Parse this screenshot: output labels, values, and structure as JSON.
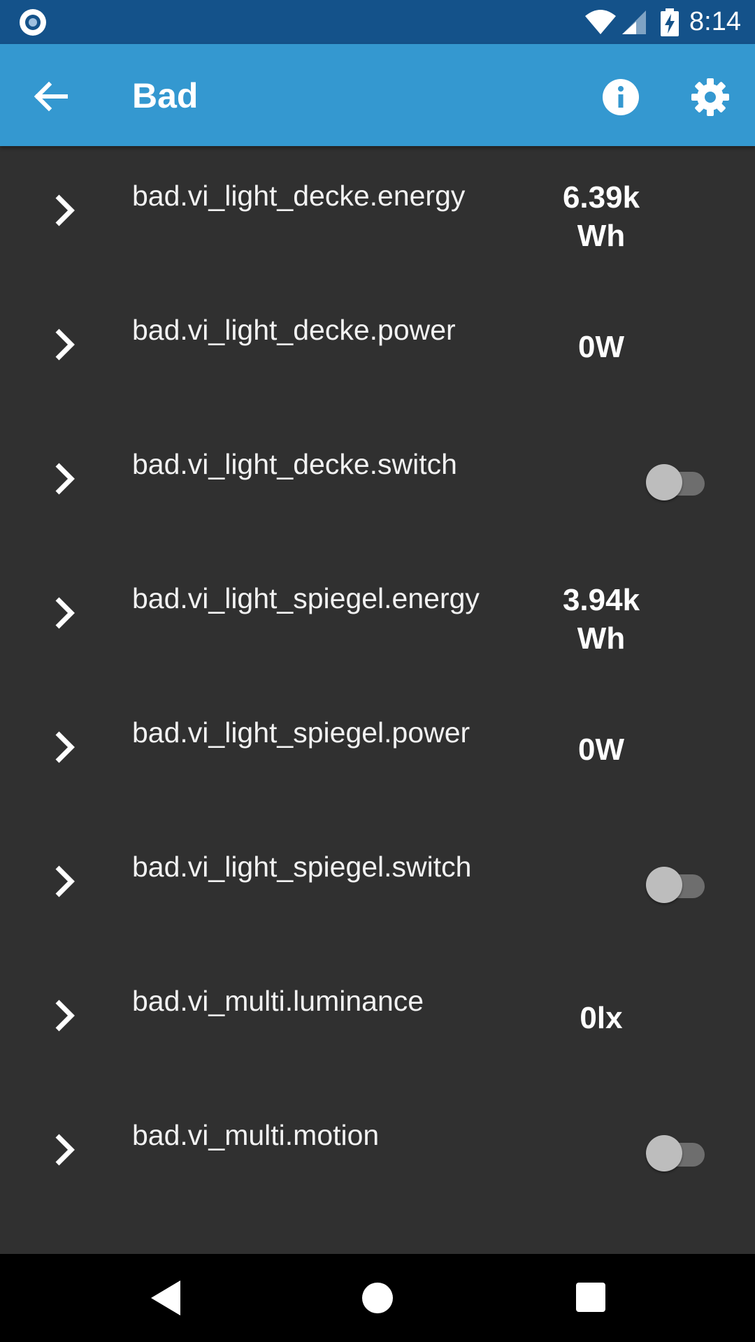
{
  "status_bar": {
    "time": "8:14",
    "icons": [
      "record-icon",
      "wifi-icon",
      "cell-signal-icon",
      "battery-charging-icon"
    ]
  },
  "app_bar": {
    "title": "Bad",
    "icons": [
      "arrow-left-icon",
      "info-icon",
      "gear-icon"
    ]
  },
  "list": {
    "items": [
      {
        "label": "bad.vi_light_decke.energy",
        "value": "6.39k",
        "value_line2": "Wh",
        "type": "value"
      },
      {
        "label": "bad.vi_light_decke.power",
        "value": "0W",
        "type": "value"
      },
      {
        "label": "bad.vi_light_decke.switch",
        "type": "switch",
        "state": "off"
      },
      {
        "label": "bad.vi_light_spiegel.energy",
        "value": "3.94k",
        "value_line2": "Wh",
        "type": "value"
      },
      {
        "label": "bad.vi_light_spiegel.power",
        "value": "0W",
        "type": "value"
      },
      {
        "label": "bad.vi_light_spiegel.switch",
        "type": "switch",
        "state": "off"
      },
      {
        "label": "bad.vi_multi.luminance",
        "value": "0lx",
        "type": "value"
      },
      {
        "label": "bad.vi_multi.motion",
        "type": "switch",
        "state": "off"
      }
    ]
  },
  "colors": {
    "status_bar": "#14528a",
    "app_bar": "#3498d0",
    "background": "#303030",
    "nav_bar": "#000000"
  },
  "nav_bar": {
    "icons": [
      "nav-back-icon",
      "nav-home-icon",
      "nav-recents-icon"
    ]
  }
}
